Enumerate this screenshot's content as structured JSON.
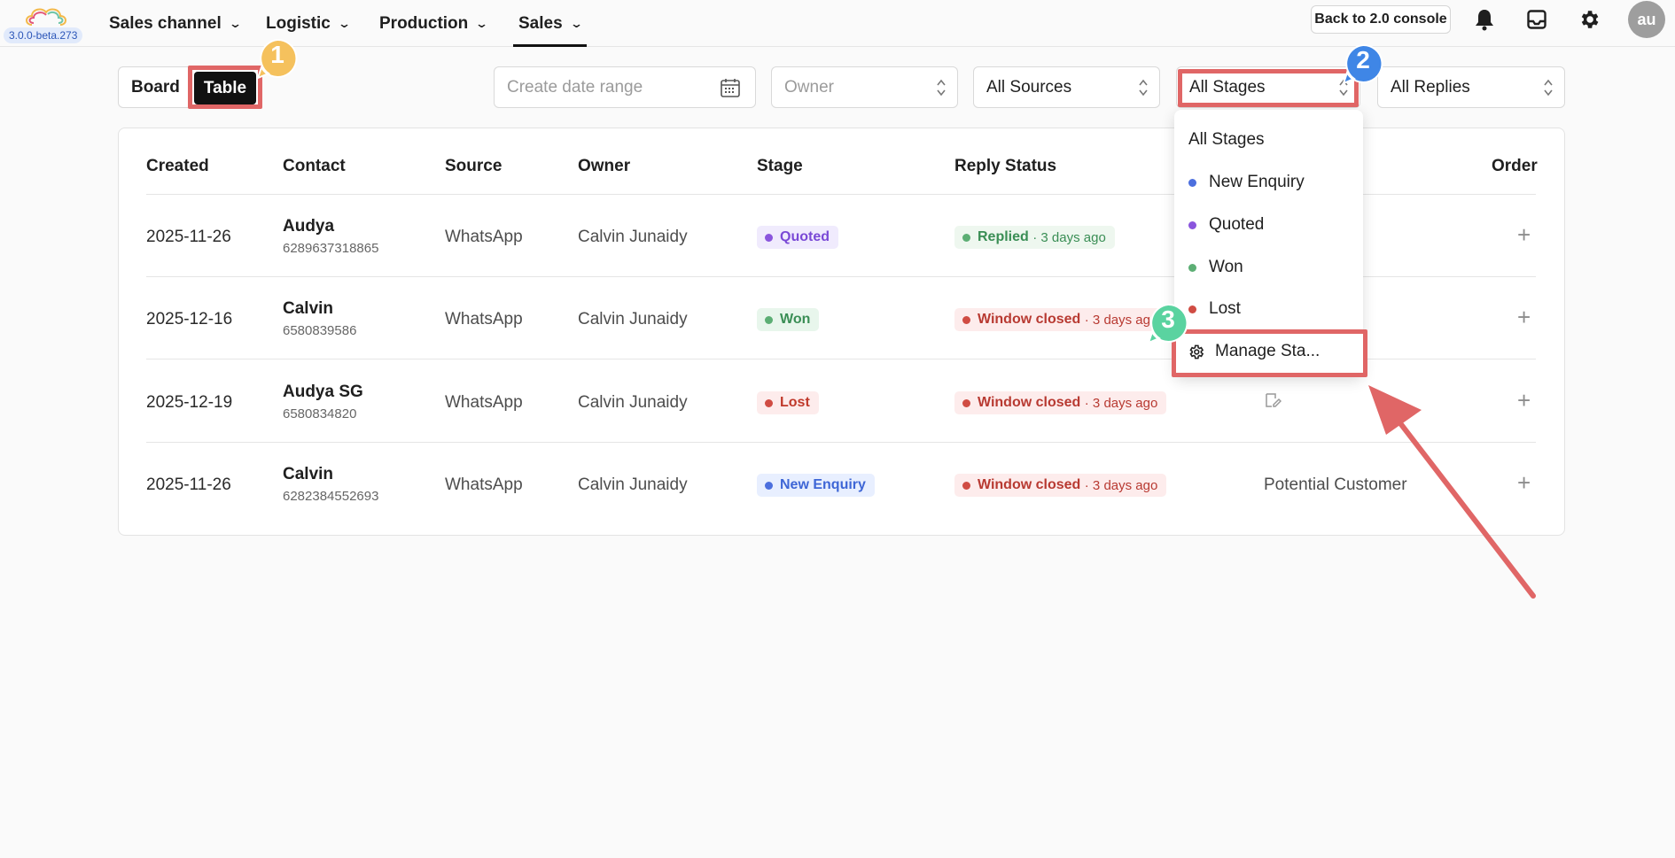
{
  "app": {
    "version": "3.0.0-beta.273",
    "nav": [
      {
        "label": "Sales channel"
      },
      {
        "label": "Logistic"
      },
      {
        "label": "Production"
      },
      {
        "label": "Sales",
        "active": true
      }
    ],
    "console_button": "Back to 2.0 console",
    "avatar_initials": "au"
  },
  "filters": {
    "view_board": "Board",
    "view_table": "Table",
    "active_view": "Table",
    "date_range_placeholder": "Create date range",
    "owner_placeholder": "Owner",
    "sources": "All Sources",
    "stages": "All Stages",
    "replies": "All Replies"
  },
  "table": {
    "columns": [
      "Created",
      "Contact",
      "Source",
      "Owner",
      "Stage",
      "Reply Status",
      "Order"
    ],
    "rows": [
      {
        "created": "2025-11-26",
        "name": "Audya",
        "phone": "6289637318865",
        "source": "WhatsApp",
        "owner": "Calvin Junaidy",
        "stage": "Quoted",
        "reply": "Replied",
        "reply_time": "· 3 days ago",
        "note": ""
      },
      {
        "created": "2025-12-16",
        "name": "Calvin",
        "phone": "6580839586",
        "source": "WhatsApp",
        "owner": "Calvin Junaidy",
        "stage": "Won",
        "reply": "Window closed",
        "reply_time": "· 3 days ago",
        "note": ""
      },
      {
        "created": "2025-12-19",
        "name": "Audya SG",
        "phone": "6580834820",
        "source": "WhatsApp",
        "owner": "Calvin Junaidy",
        "stage": "Lost",
        "reply": "Window closed",
        "reply_time": "· 3 days ago",
        "note": ""
      },
      {
        "created": "2025-11-26",
        "name": "Calvin",
        "phone": "6282384552693",
        "source": "WhatsApp",
        "owner": "Calvin Junaidy",
        "stage": "New Enquiry",
        "reply": "Window closed",
        "reply_time": "· 3 days ago",
        "note": "Potential Customer"
      }
    ]
  },
  "stage_dropdown": {
    "items": [
      {
        "label": "All Stages",
        "color": ""
      },
      {
        "label": "New Enquiry",
        "color": "#4c6fde"
      },
      {
        "label": "Quoted",
        "color": "#8a55dd"
      },
      {
        "label": "Won",
        "color": "#5cae74"
      },
      {
        "label": "Lost",
        "color": "#d04c43"
      }
    ],
    "manage_label": "Manage Sta..."
  },
  "colors": {
    "accent_dark": "#111111",
    "highlight": "#e06666",
    "marker_1": "#f5c15d",
    "marker_2": "#3f86e6",
    "marker_3": "#5ad3a0"
  },
  "annotations": {
    "marker_1": "1",
    "marker_2": "2",
    "marker_3": "3"
  }
}
